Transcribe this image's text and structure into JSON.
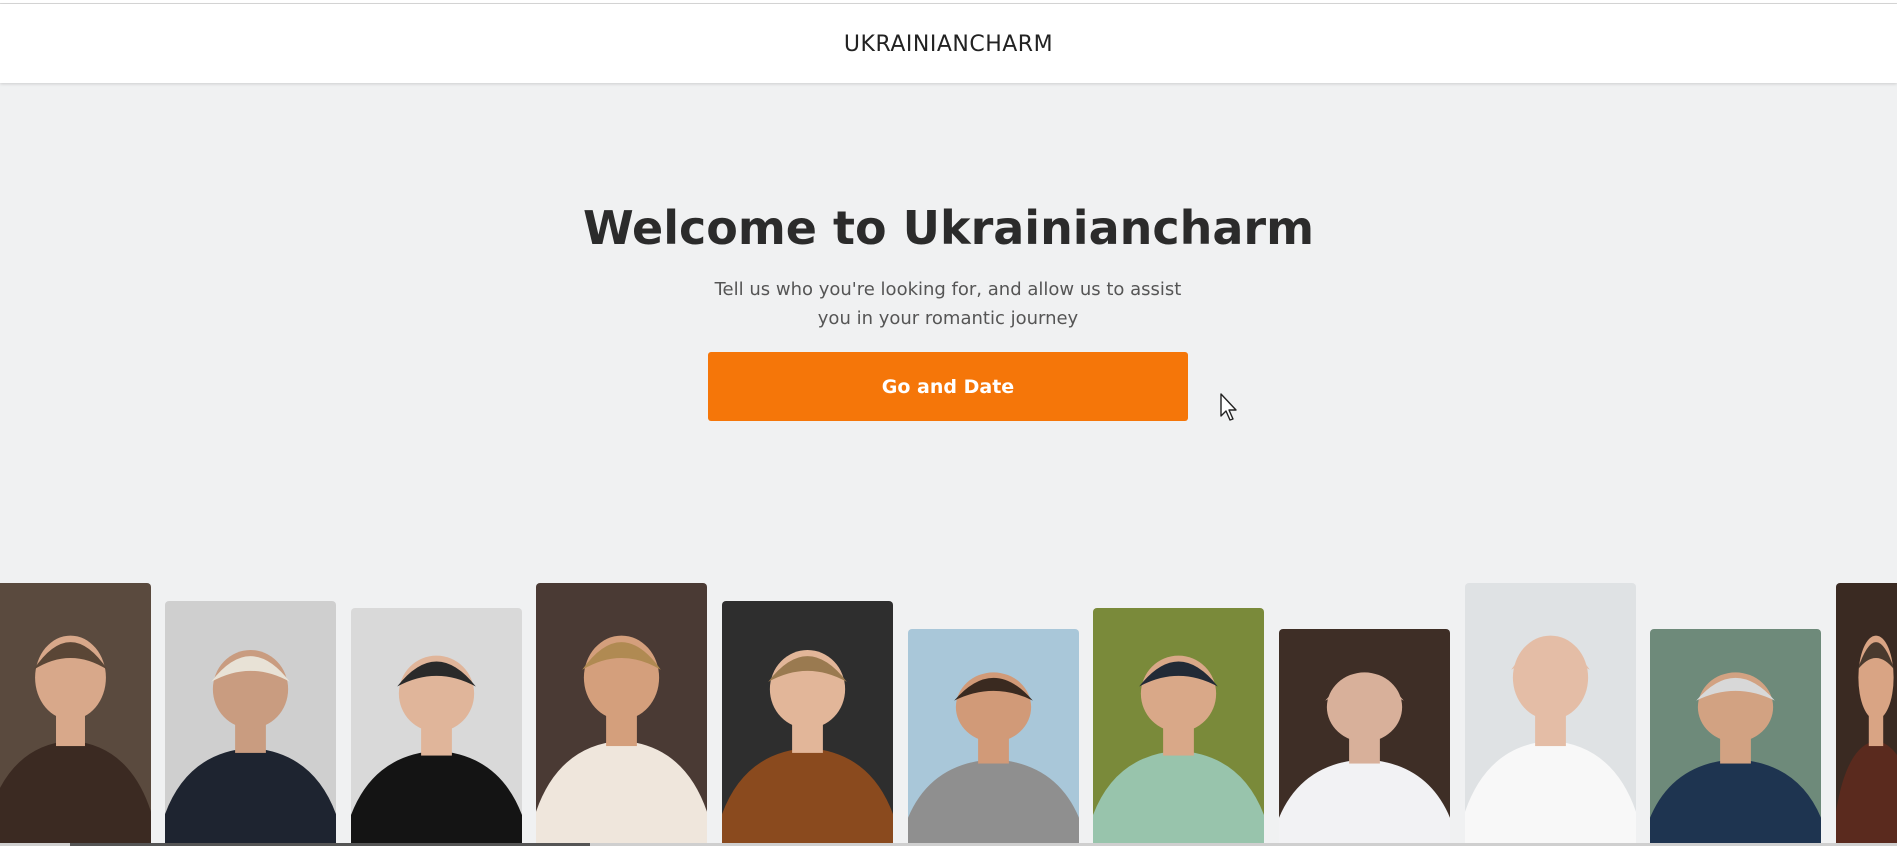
{
  "header": {
    "logo_text": "UKRAINIANCHARM"
  },
  "hero": {
    "title": "Welcome to Ukrainiancharm",
    "subtitle": "Tell us who you're looking for, and allow us to assist you in your romantic journey",
    "cta_label": "Go and Date"
  },
  "colors": {
    "accent": "#f57609",
    "background": "#f0f1f2",
    "header_bg": "#ffffff"
  },
  "gallery": {
    "photos": [
      {
        "name": "profile-photo-1",
        "bg": "#5a4a3e",
        "shirt": "#3b2a22",
        "skin": "#d8a88a",
        "hair": "#5a4636"
      },
      {
        "name": "profile-photo-2",
        "bg": "#cfcfcf",
        "shirt": "#1e2430",
        "skin": "#c99c80",
        "hair": "#e8e2d6"
      },
      {
        "name": "profile-photo-3",
        "bg": "#d9d9d9",
        "shirt": "#141414",
        "skin": "#e0b59a",
        "hair": "#2a2a2a"
      },
      {
        "name": "profile-photo-4",
        "bg": "#4a3a34",
        "shirt": "#efe6dc",
        "skin": "#d49f7c",
        "hair": "#b08a52"
      },
      {
        "name": "profile-photo-5",
        "bg": "#2e2e2e",
        "shirt": "#8a4a1e",
        "skin": "#e2b699",
        "hair": "#9a7a50"
      },
      {
        "name": "profile-photo-6",
        "bg": "#a9c7d9",
        "shirt": "#8f8f8f",
        "skin": "#d19a78",
        "hair": "#3a2a20"
      },
      {
        "name": "profile-photo-7",
        "bg": "#7a8a3a",
        "shirt": "#98c4ac",
        "skin": "#d9a888",
        "hair": "#222a36"
      },
      {
        "name": "profile-photo-8",
        "bg": "#3e2e26",
        "shirt": "#f2f2f4",
        "skin": "#d8b09a",
        "hair": "#d8b09a"
      },
      {
        "name": "profile-photo-9",
        "bg": "#dfe2e4",
        "shirt": "#f8f8f8",
        "skin": "#e4bda6",
        "hair": "#e4bda6"
      },
      {
        "name": "profile-photo-10",
        "bg": "#6e8a7a",
        "shirt": "#1e3450",
        "skin": "#d2a282",
        "hair": "#d8d8d8"
      },
      {
        "name": "profile-photo-11",
        "bg": "#3a2a22",
        "shirt": "#5a2a1e",
        "skin": "#d9a484",
        "hair": "#4a3a2e"
      }
    ]
  }
}
